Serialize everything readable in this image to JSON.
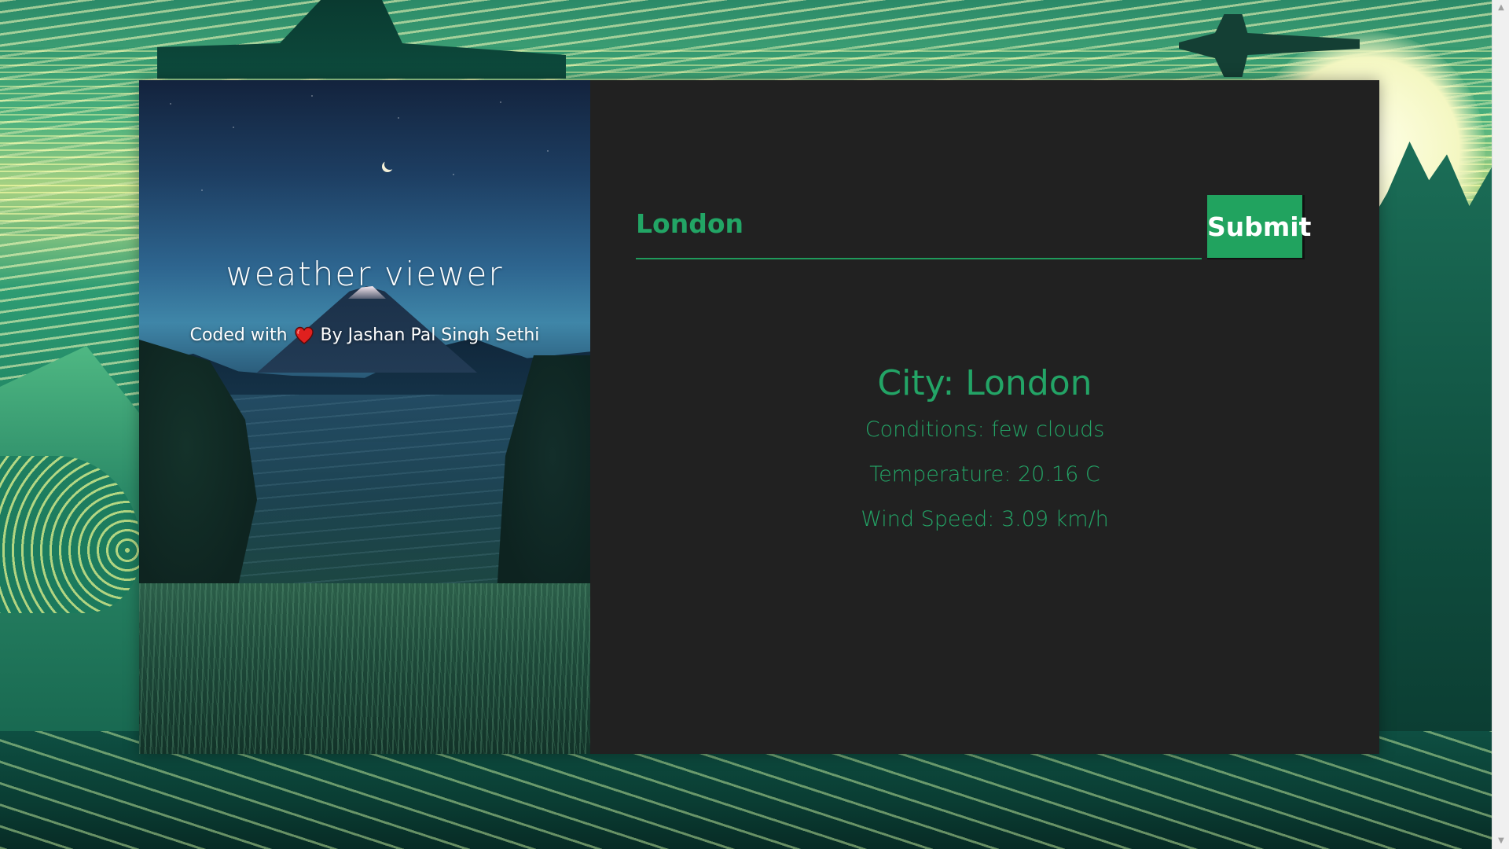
{
  "app": {
    "title": "weather viewer",
    "credit_prefix": "Coded with",
    "credit_suffix": "By Jashan Pal Singh Sethi",
    "heart_icon": "heart-icon"
  },
  "search": {
    "value": "London",
    "placeholder": "",
    "submit_label": "Submit"
  },
  "weather": {
    "city": "City: London",
    "conditions": "Conditions: few clouds",
    "temperature": "Temperature: 20.16 C",
    "wind_speed": "Wind Speed: 3.09 km/h"
  },
  "colors": {
    "accent_green": "#21a35f",
    "panel_dark": "#212121",
    "text_white": "#ffffff",
    "heart_red": "#e0201e"
  },
  "scrollbar": {
    "up_arrow": "▲",
    "down_arrow": "▼"
  }
}
